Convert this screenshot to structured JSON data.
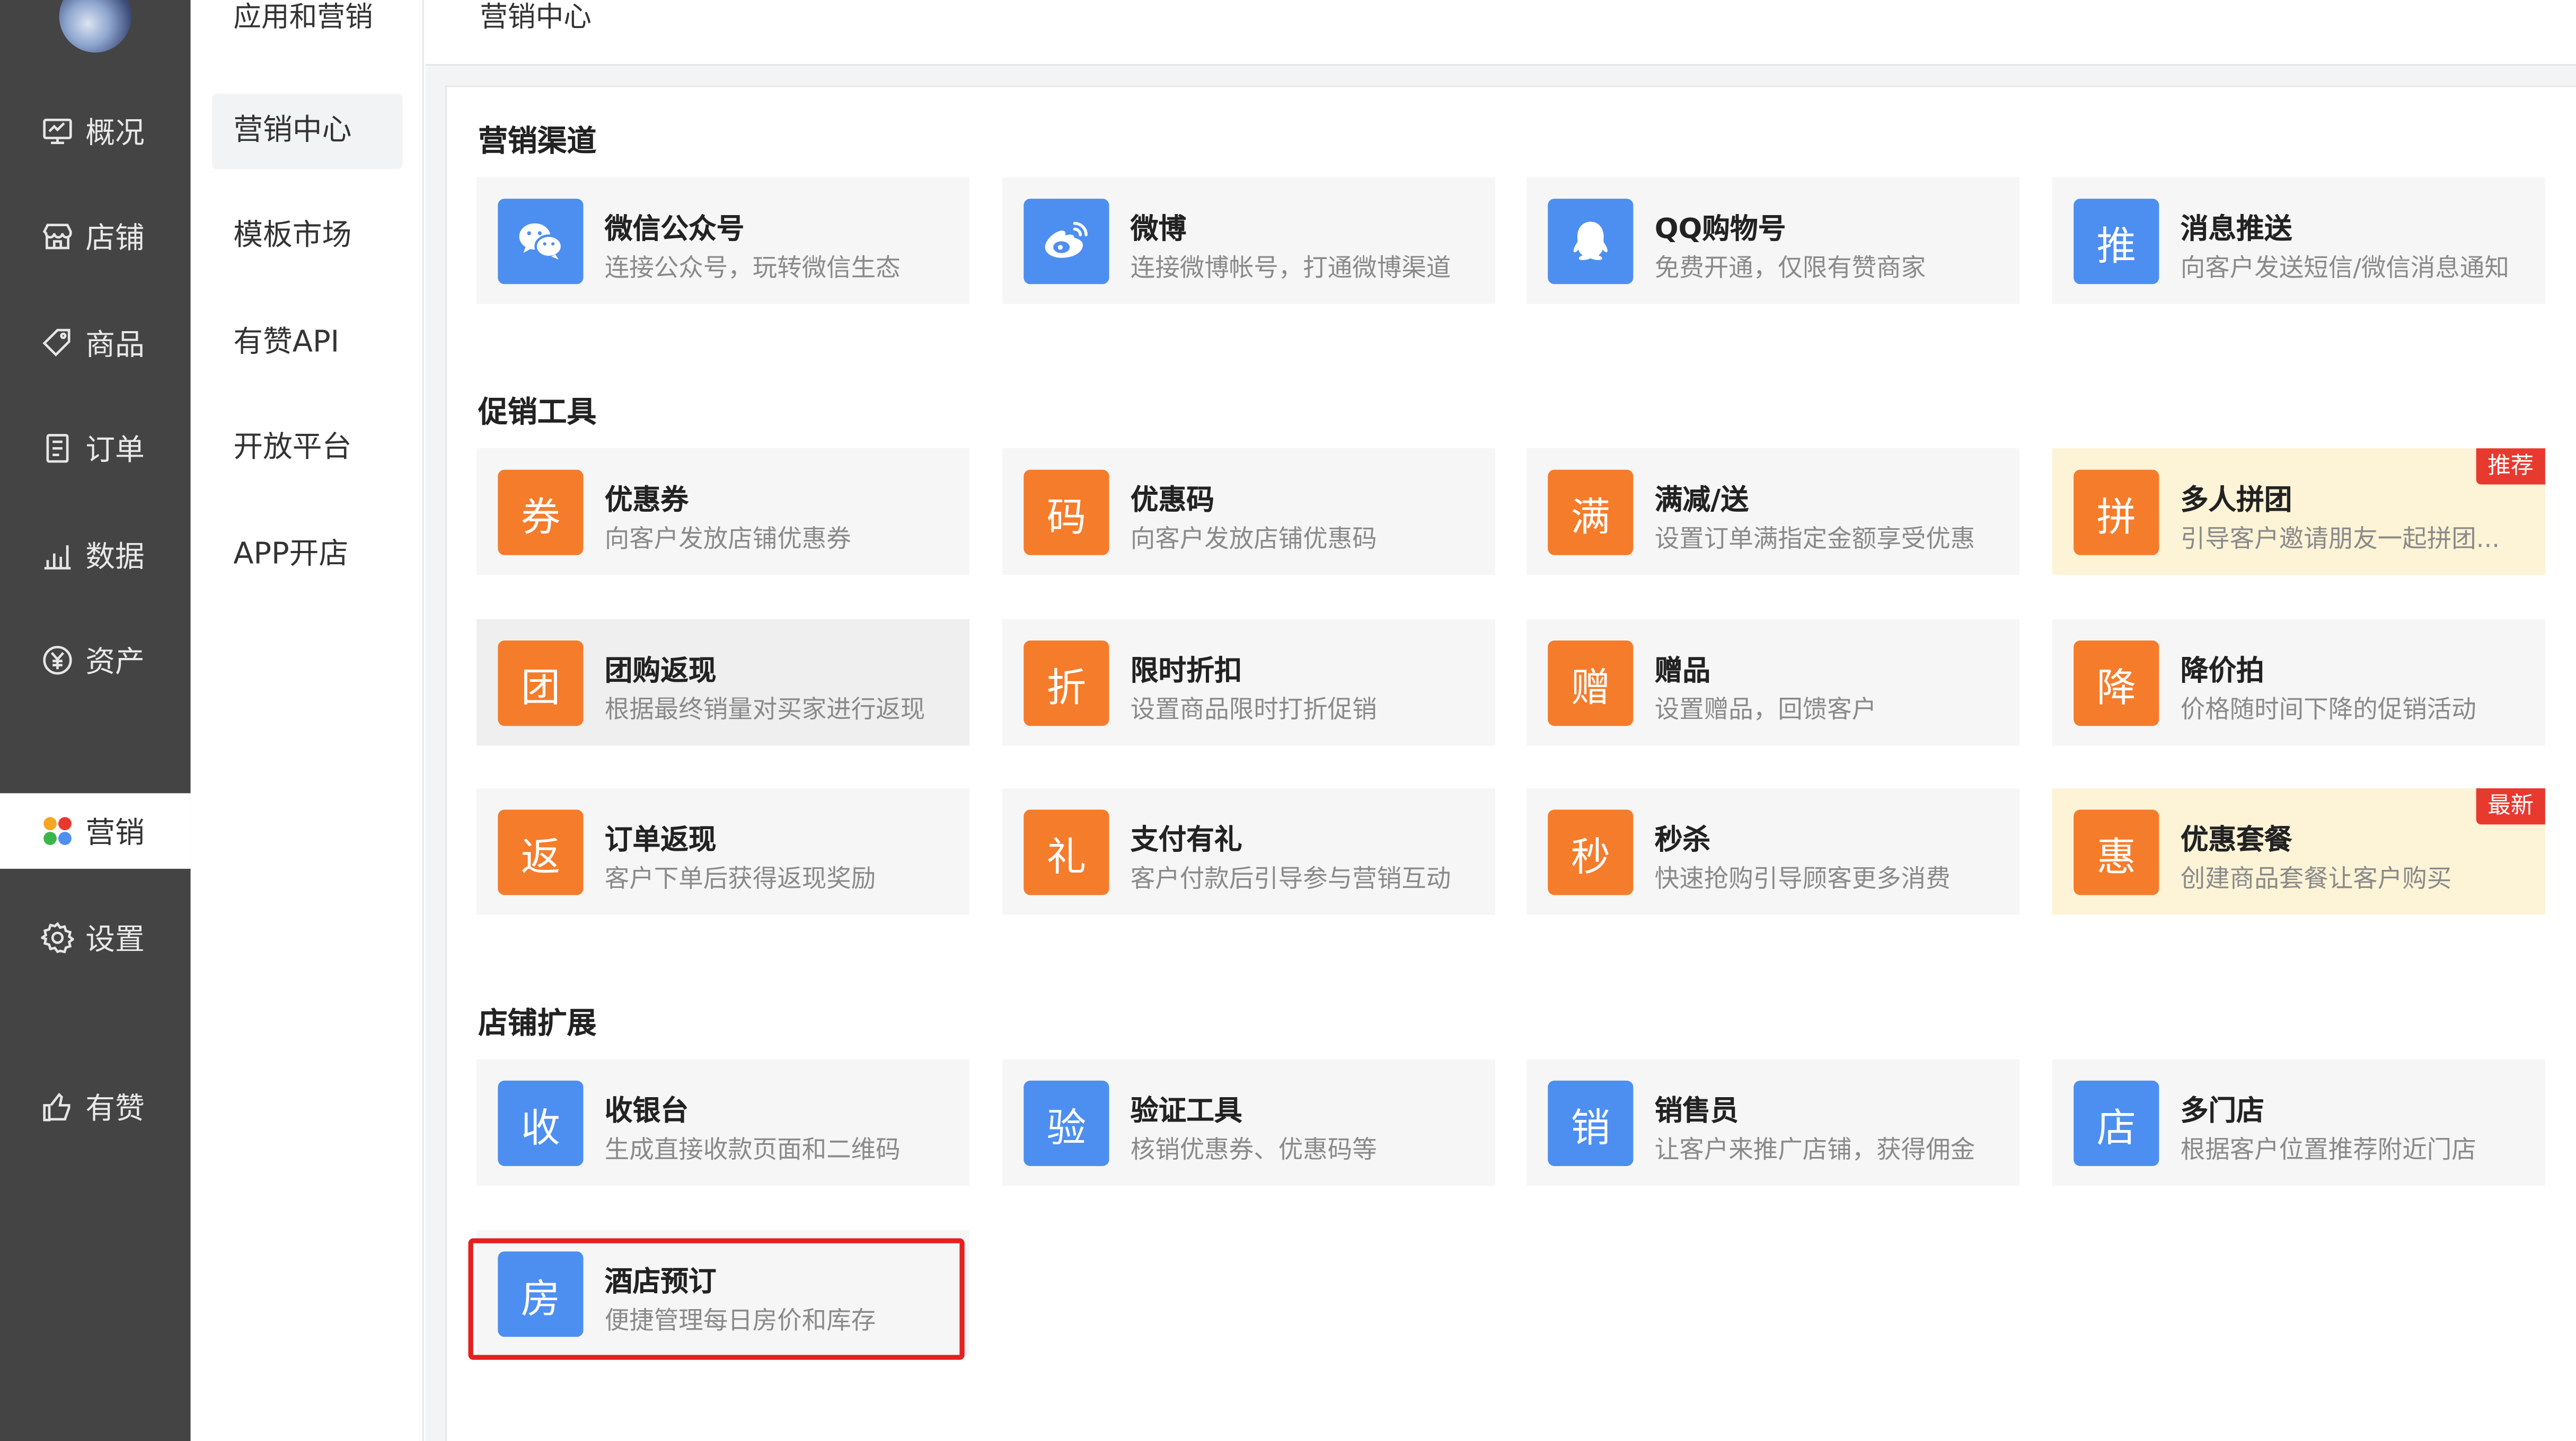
{
  "colors": {
    "accent_orange": "#f57c2b",
    "accent_blue": "#4d8ff0",
    "tag_red": "#e8392f",
    "highlight_red": "#e61f1f"
  },
  "mainnav": {
    "items": [
      {
        "label": "概况",
        "icon": "dashboard-icon"
      },
      {
        "label": "店铺",
        "icon": "store-icon"
      },
      {
        "label": "商品",
        "icon": "tag-icon"
      },
      {
        "label": "订单",
        "icon": "document-icon"
      },
      {
        "label": "数据",
        "icon": "bar-chart-icon"
      },
      {
        "label": "资产",
        "icon": "yen-icon"
      },
      {
        "label": "营销",
        "icon": "apps-icon"
      },
      {
        "label": "设置",
        "icon": "gear-icon"
      },
      {
        "label": "有赞",
        "icon": "thumbs-up-icon"
      }
    ]
  },
  "subnav": {
    "title": "应用和营销",
    "items": [
      "营销中心",
      "模板市场",
      "有赞API",
      "开放平台",
      "APP开店"
    ]
  },
  "header": {
    "breadcrumb": "营销中心"
  },
  "sections": [
    {
      "title": "营销渠道",
      "cards": [
        {
          "name": "微信公众号",
          "desc": "连接公众号，玩转微信生态",
          "icon": "wechat-icon"
        },
        {
          "name": "微博",
          "desc": "连接微博帐号，打通微博渠道",
          "icon": "weibo-icon"
        },
        {
          "name": "QQ购物号",
          "desc": "免费开通，仅限有赞商家",
          "icon": "qq-icon"
        },
        {
          "name": "消息推送",
          "desc": "向客户发送短信/微信消息通知",
          "glyph": "推"
        }
      ]
    },
    {
      "title": "促销工具",
      "cards": [
        {
          "name": "优惠券",
          "desc": "向客户发放店铺优惠券",
          "glyph": "券"
        },
        {
          "name": "优惠码",
          "desc": "向客户发放店铺优惠码",
          "glyph": "码"
        },
        {
          "name": "满减/送",
          "desc": "设置订单满指定金额享受优惠",
          "glyph": "满"
        },
        {
          "name": "多人拼团",
          "desc": "引导客户邀请朋友一起拼团...",
          "glyph": "拼",
          "tag": "推荐"
        },
        {
          "name": "团购返现",
          "desc": "根据最终销量对买家进行返现",
          "glyph": "团"
        },
        {
          "name": "限时折扣",
          "desc": "设置商品限时打折促销",
          "glyph": "折"
        },
        {
          "name": "赠品",
          "desc": "设置赠品，回馈客户",
          "glyph": "赠"
        },
        {
          "name": "降价拍",
          "desc": "价格随时间下降的促销活动",
          "glyph": "降"
        },
        {
          "name": "订单返现",
          "desc": "客户下单后获得返现奖励",
          "glyph": "返"
        },
        {
          "name": "支付有礼",
          "desc": "客户付款后引导参与营销互动",
          "glyph": "礼"
        },
        {
          "name": "秒杀",
          "desc": "快速抢购引导顾客更多消费",
          "glyph": "秒"
        },
        {
          "name": "优惠套餐",
          "desc": "创建商品套餐让客户购买",
          "glyph": "惠",
          "tag": "最新"
        }
      ]
    },
    {
      "title": "店铺扩展",
      "cards": [
        {
          "name": "收银台",
          "desc": "生成直接收款页面和二维码",
          "glyph": "收"
        },
        {
          "name": "验证工具",
          "desc": "核销优惠券、优惠码等",
          "glyph": "验"
        },
        {
          "name": "销售员",
          "desc": "让客户来推广店铺，获得佣金",
          "glyph": "销"
        },
        {
          "name": "多门店",
          "desc": "根据客户位置推荐附近门店",
          "glyph": "店"
        },
        {
          "name": "酒店预订",
          "desc": "便捷管理每日房价和库存",
          "glyph": "房"
        }
      ]
    }
  ]
}
